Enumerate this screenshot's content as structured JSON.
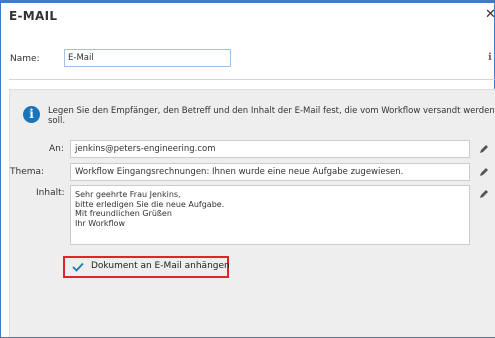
{
  "dialog": {
    "title": "E-MAIL",
    "close_symbol": "✕",
    "name_label": "Name:",
    "name_value": "E-Mail"
  },
  "info": {
    "icon": "info-icon",
    "text": "Legen Sie den Empfänger, den Betreff und den Inhalt der E-Mail fest, die vom Workflow versandt werden soll."
  },
  "fields": {
    "to_label": "An:",
    "to_value": "jenkins@peters-engineering.com",
    "subject_label": "Thema:",
    "subject_value": "Workflow Eingangsrechnungen: Ihnen wurde eine neue Aufgabe zugewiesen.",
    "body_label": "Inhalt:",
    "body_lines": [
      "Sehr geehrte Frau Jenkins,",
      "bitte erledigen Sie die neue Aufgabe.",
      "Mit freundlichen Grüßen",
      "Ihr Workflow"
    ]
  },
  "attach": {
    "checked": true,
    "label": "Dokument an E-Mail anhängen",
    "highlight_color": "#e0242b"
  },
  "colors": {
    "accent": "#1b75bb",
    "frame_border": "#3d7dc8",
    "panel_bg": "#eeeeee"
  }
}
